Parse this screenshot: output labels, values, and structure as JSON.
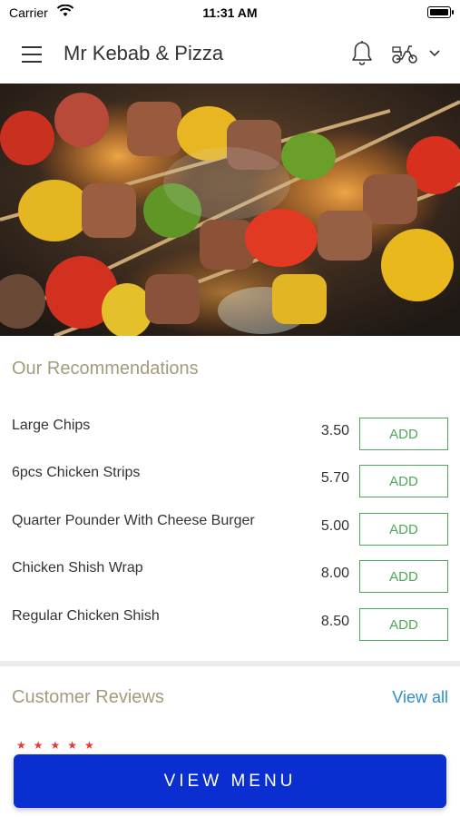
{
  "status_bar": {
    "carrier": "Carrier",
    "time": "11:31 AM"
  },
  "header": {
    "title": "Mr Kebab & Pizza"
  },
  "recommendations": {
    "title": "Our Recommendations",
    "items": [
      {
        "name": "Large Chips",
        "price": "3.50",
        "button": "ADD"
      },
      {
        "name": "6pcs Chicken Strips",
        "price": "5.70",
        "button": "ADD"
      },
      {
        "name": "Quarter Pounder With Cheese Burger",
        "price": "5.00",
        "button": "ADD"
      },
      {
        "name": "Chicken Shish Wrap",
        "price": "8.00",
        "button": "ADD"
      },
      {
        "name": "Regular Chicken Shish",
        "price": "8.50",
        "button": "ADD"
      }
    ]
  },
  "reviews": {
    "title": "Customer Reviews",
    "view_all": "View all",
    "stars": "★★★★★"
  },
  "cta": {
    "label": "VIEW MENU"
  },
  "colors": {
    "accent_green": "#4ea85a",
    "section_title": "#a49b7d",
    "link_blue": "#2f8fc2",
    "cta_blue": "#0a2ed0"
  }
}
